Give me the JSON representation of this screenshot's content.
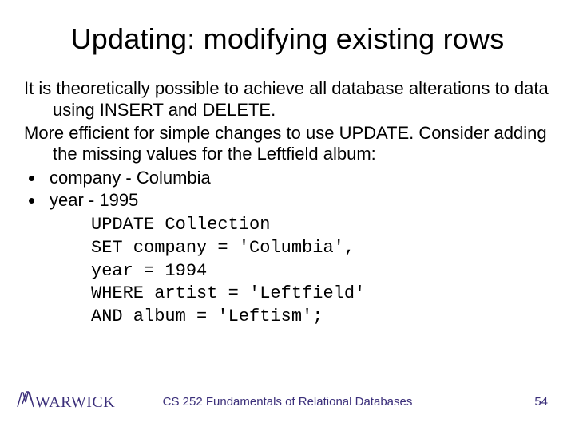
{
  "title": "Updating: modifying existing rows",
  "paragraphs": [
    "It is theoretically possible to achieve all database alterations to data using INSERT and DELETE.",
    "More efficient for simple changes to use UPDATE. Consider adding the missing values for the Leftfield album:"
  ],
  "bullets": [
    "company - Columbia",
    "year - 1995"
  ],
  "code": "UPDATE Collection\nSET company = 'Columbia',\nyear = 1994\nWHERE artist = 'Leftfield'\nAND album = 'Leftism';",
  "footer": {
    "logo_text": "WARWICK",
    "course": "CS 252 Fundamentals of Relational Databases",
    "page": "54"
  }
}
